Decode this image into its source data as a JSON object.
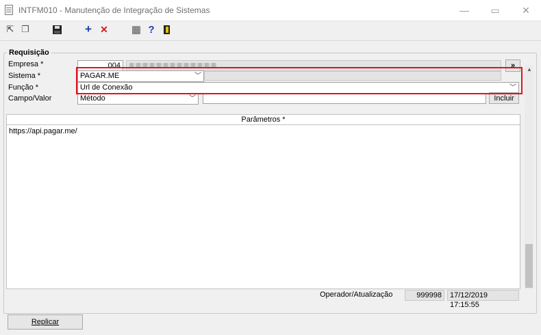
{
  "window": {
    "title": "INTFM010 - Manutenção de Integração de Sistemas",
    "min_glyph": "—",
    "restore_glyph": "▭",
    "close_glyph": "✕"
  },
  "toolbar": {
    "buttons": [
      {
        "name": "navigate-icon",
        "glyph": "⇱"
      },
      {
        "name": "windows-icon",
        "glyph": "❐"
      },
      {
        "name": "save-icon",
        "glyph": "💾"
      },
      {
        "name": "add-icon",
        "glyph": "+"
      },
      {
        "name": "delete-icon",
        "glyph": "✕"
      },
      {
        "name": "calendar-icon",
        "glyph": "▦"
      },
      {
        "name": "help-icon",
        "glyph": "?"
      },
      {
        "name": "exit-icon",
        "glyph": "⎗"
      }
    ]
  },
  "form": {
    "group_title": "Requisição",
    "empresa_label": "Empresa *",
    "empresa_code": "004",
    "empresa_name": "",
    "lookup_label": "»",
    "sistema_label": "Sistema *",
    "sistema_value": "PAGAR.ME",
    "funcao_label": "Função *",
    "funcao_value": "Url de Conexão",
    "campo_label": "Campo/Valor",
    "campo_select": "Método",
    "campo_value": "",
    "incluir_label": "Incluir"
  },
  "grid": {
    "header": "Parâmetros *",
    "content": "https://api.pagar.me/"
  },
  "footer": {
    "operador_label": "Operador/Atualização",
    "operador_code": "999998",
    "timestamp": "17/12/2019 17:15:55",
    "replicar_label": "Replicar"
  },
  "colors": {
    "highlight": "#e0121d",
    "add": "#1a3fb0",
    "delete": "#d41c1c"
  }
}
